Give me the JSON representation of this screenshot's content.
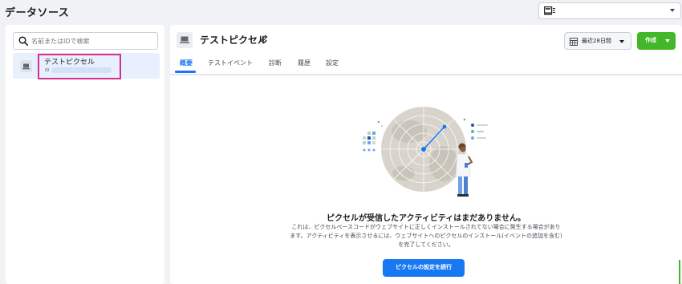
{
  "page": {
    "title": "データソース"
  },
  "account_selector": {
    "icon": "account-card-icon"
  },
  "sidebar": {
    "search": {
      "placeholder": "名前またはIDで検索",
      "value": ""
    },
    "pixels": [
      {
        "name": "テストピクセル",
        "id_label": "ID",
        "icon": "laptop-icon"
      }
    ]
  },
  "main": {
    "title": "テストピクセル",
    "tabs": [
      {
        "label": "概要",
        "active": true
      },
      {
        "label": "テストイベント",
        "active": false
      },
      {
        "label": "診断",
        "active": false
      },
      {
        "label": "履歴",
        "active": false
      },
      {
        "label": "設定",
        "active": false
      }
    ],
    "date_range": {
      "label": "最近28日間"
    },
    "create_button": {
      "label": "作成"
    },
    "empty_state": {
      "title": "ピクセルが受信したアクティビティはまだありません。",
      "description": "これは、ピクセルベースコードがウェブサイトに正しくインストールされてない場合に発生する場合があります。アクティビティを表示させるには、ウェブサイトへのピクセルのインストール(イベントの追加を含む)を完了してください。",
      "cta_label": "ピクセルの設定を続行"
    }
  },
  "colors": {
    "primary": "#1877f2",
    "create_green": "#42b72a",
    "selection_highlight": "#d62f91",
    "selected_item_bg": "#e7f0fc",
    "page_bg": "#f0f2f5"
  }
}
